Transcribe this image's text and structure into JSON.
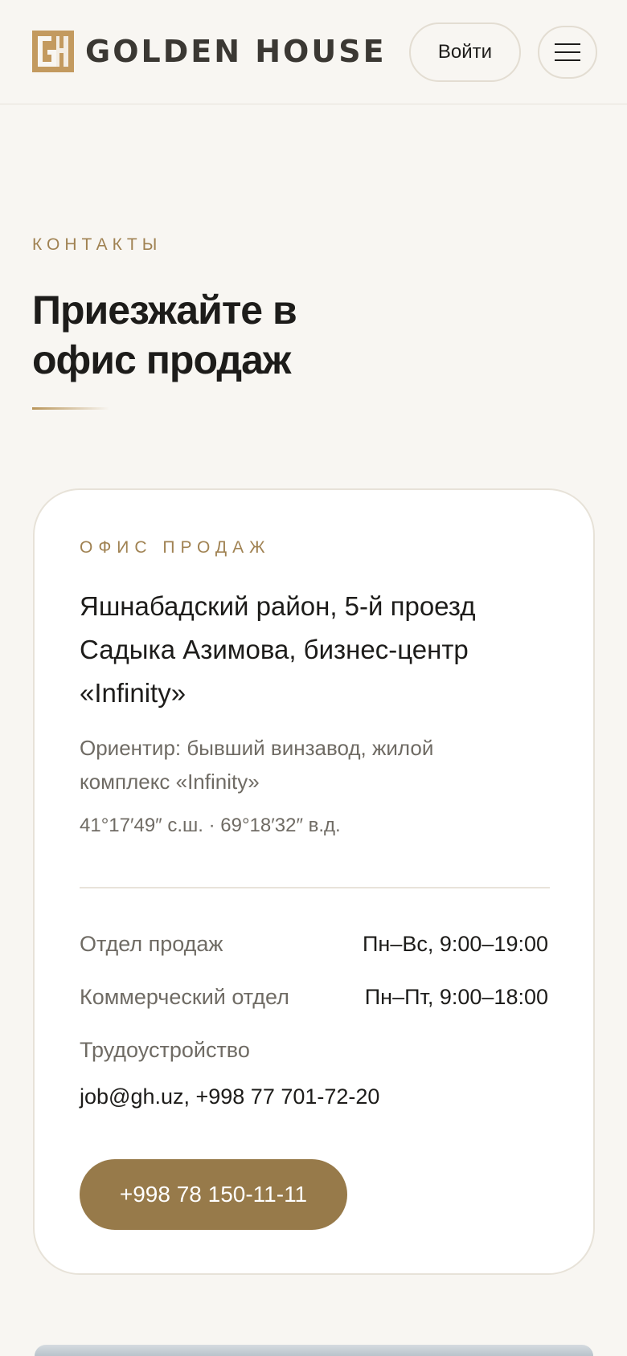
{
  "header": {
    "brand": "GOLDEN HOUSE",
    "login_label": "Войти"
  },
  "section": {
    "eyebrow": "КОНТАКТЫ",
    "title": "Приезжайте в офис продаж"
  },
  "card": {
    "eyebrow": "ОФИС ПРОДАЖ",
    "address": "Яшнабадский район, 5-й проезд Садыка Азимова, бизнес-центр «Infinity»",
    "landmark": "Ориентир: бывший винзавод, жилой комплекс «Infinity»",
    "coordinates": "41°17′49″ с.ш. · 69°18′32″ в.д.",
    "schedule": [
      {
        "label": "Отдел продаж",
        "value": "Пн–Вс, 9:00–19:00"
      },
      {
        "label": "Коммерческий отдел",
        "value": "Пн–Пт, 9:00–18:00"
      }
    ],
    "jobs_label": "Трудоустройство",
    "jobs_contact": "job@gh.uz, +998 77 701-72-20",
    "phone_button": "+998 78 150-11-11"
  },
  "colors": {
    "accent": "#977a4a",
    "eyebrow": "#a08252",
    "background": "#f8f6f2"
  }
}
